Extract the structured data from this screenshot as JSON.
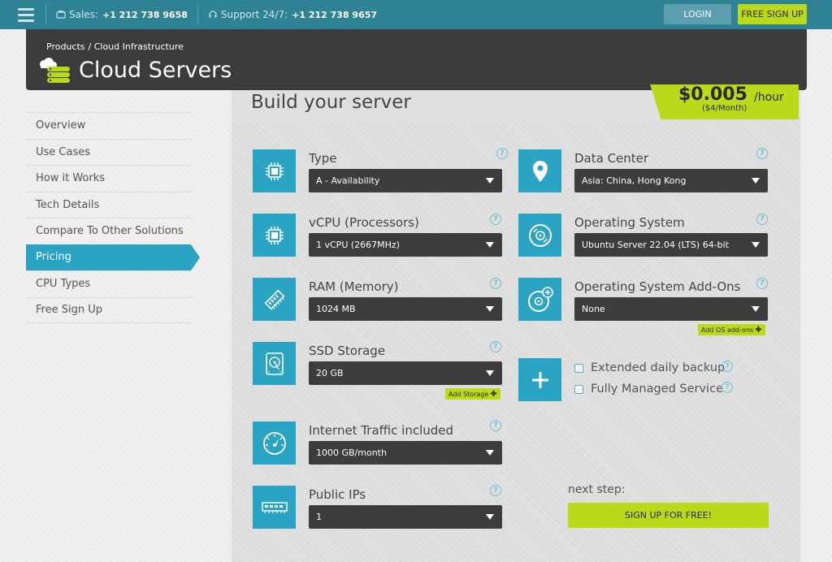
{
  "topbar": {
    "sales_label": "Sales:",
    "sales_number": "+1 212 738 9658",
    "support_label": "Support 24/7:",
    "support_number": "+1 212 738 9657",
    "login_label": "LOGIN",
    "free_signup_label": "FREE SIGN UP"
  },
  "header": {
    "breadcrumb": [
      "Products",
      "/ Cloud Infrastructure"
    ],
    "title": "Cloud Servers"
  },
  "sidebar": {
    "items": [
      {
        "label": "Overview"
      },
      {
        "label": "Use Cases"
      },
      {
        "label": "How it Works"
      },
      {
        "label": "Tech Details"
      },
      {
        "label": "Compare To Other Solutions"
      },
      {
        "label": "Pricing",
        "active": true
      },
      {
        "label": "CPU Types"
      },
      {
        "label": "Free Sign Up"
      }
    ]
  },
  "build": {
    "title": "Build your server",
    "price": "$0.005",
    "price_unit": "/hour",
    "price_month": "($4/Month)"
  },
  "options": {
    "type": {
      "label": "Type",
      "value": "A - Availability",
      "icon": "chip-icon"
    },
    "vcpu": {
      "label": "vCPU (Processors)",
      "value": "1 vCPU (2667MHz)",
      "icon": "chip-icon"
    },
    "ram": {
      "label": "RAM (Memory)",
      "value": "1024 MB",
      "icon": "memory-icon"
    },
    "ssd": {
      "label": "SSD Storage",
      "value": "20 GB",
      "icon": "hard-drive-icon",
      "add_label": "Add Storage"
    },
    "traffic": {
      "label": "Internet Traffic included",
      "value": "1000 GB/month",
      "icon": "speedometer-icon"
    },
    "ips": {
      "label": "Public IPs",
      "value": "1",
      "icon": "ip-address-icon"
    },
    "datacenter": {
      "label": "Data Center",
      "value": "Asia: China, Hong Kong",
      "icon": "map-pin-icon"
    },
    "os": {
      "label": "Operating System",
      "value": "Ubuntu Server 22.04 (LTS) 64-bit",
      "icon": "disc-icon"
    },
    "os_addons": {
      "label": "Operating System Add-Ons",
      "value": "None",
      "icon": "disc-plus-icon",
      "add_label": "Add OS add-ons"
    }
  },
  "extras": {
    "icon": "plus-icon",
    "backup_label": "Extended daily backup",
    "managed_label": "Fully Managed Service"
  },
  "next": {
    "label": "next step:",
    "button_label": "SIGN UP FOR FREE!"
  },
  "colors": {
    "topbar": "#2f8294",
    "accent_blue": "#2ba3c3",
    "accent_green": "#bcd81a",
    "header": "#3b3b3b"
  }
}
